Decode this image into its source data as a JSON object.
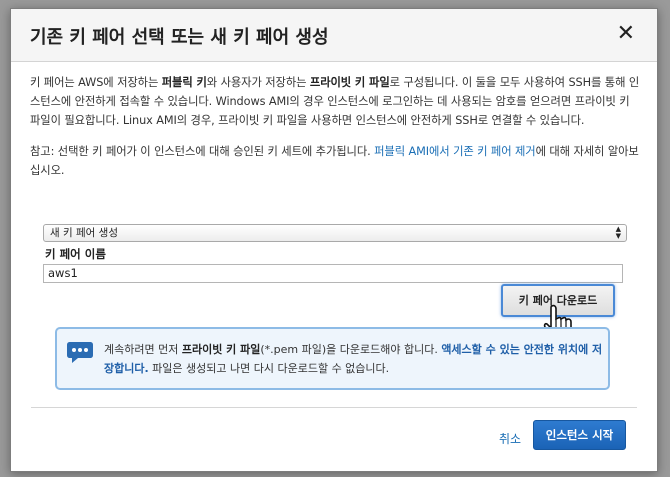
{
  "dialog": {
    "title": "기존 키 페어 선택 또는 새 키 페어 생성",
    "close_glyph": "✕"
  },
  "description": {
    "p1_a": "키 페어는 AWS에 저장하는 ",
    "p1_b": "퍼블릭 키",
    "p1_c": "와 사용자가 저장하는 ",
    "p1_d": "프라이빗 키 파일",
    "p1_e": "로 구성됩니다. 이 둘을 모두 사용하여 SSH를 통해 인스턴스에 안전하게 접속할 수 있습니다. Windows AMI의 경우 인스턴스에 로그인하는 데 사용되는 암호를 얻으려면 프라이빗 키 파일이 필요합니다. Linux AMI의 경우, 프라이빗 키 파일을 사용하면 인스턴스에 안전하게 SSH로 연결할 수 있습니다.",
    "p2_a": "참고: 선택한 키 페어가 이 인스턴스에 대해 승인된 키 세트에 추가됩니다. ",
    "p2_link": "퍼블릭 AMI에서 기존 키 페어 제거",
    "p2_b": "에 대해 자세히 알아보십시오."
  },
  "keypair": {
    "select_value": "새 키 페어 생성",
    "name_label": "키 페어 이름",
    "name_value": "aws1",
    "download_button": "키 페어 다운로드"
  },
  "info": {
    "t1": "계속하려면 먼저 ",
    "t2": "프라이빗 키 파일",
    "t3": "(*.pem 파일)을 다운로드해야 합니다. ",
    "t4": "액세스할 수 있는 안전한 위치에 저장합니다.",
    "t5": " 파일은 생성되고 나면 다시 다운로드할 수 없습니다."
  },
  "footer": {
    "cancel": "취소",
    "launch": "인스턴스 시작"
  },
  "colors": {
    "primary": "#1b63b6",
    "link": "#1a6eb5",
    "info_bg": "#eef5fc"
  }
}
